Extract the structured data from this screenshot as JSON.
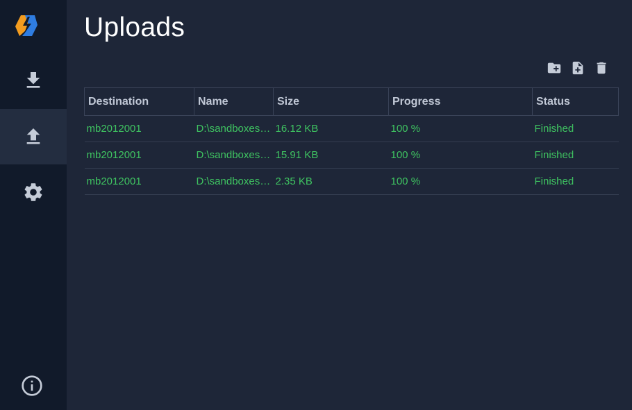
{
  "page": {
    "title": "Uploads"
  },
  "sidebar": {
    "logo": "app-logo",
    "items": [
      {
        "icon": "download-icon",
        "active": false
      },
      {
        "icon": "upload-icon",
        "active": true
      },
      {
        "icon": "gear-icon",
        "active": false
      }
    ],
    "footer_icon": "info-icon"
  },
  "toolbar": {
    "buttons": [
      {
        "icon": "add-folder-icon"
      },
      {
        "icon": "add-file-icon"
      },
      {
        "icon": "trash-icon"
      }
    ]
  },
  "table": {
    "columns": [
      "Destination",
      "Name",
      "Size",
      "Progress",
      "Status"
    ],
    "rows": [
      {
        "destination": "mb2012001",
        "name": "D:\\sandboxes\\...",
        "size": "16.12 KB",
        "progress": "100 %",
        "status": "Finished"
      },
      {
        "destination": "mb2012001",
        "name": "D:\\sandboxes\\...",
        "size": "15.91 KB",
        "progress": "100 %",
        "status": "Finished"
      },
      {
        "destination": "mb2012001",
        "name": "D:\\sandboxes\\...",
        "size": "2.35 KB",
        "progress": "100 %",
        "status": "Finished"
      }
    ]
  },
  "colors": {
    "background": "#1e2638",
    "sidebar": "#111a2a",
    "sidebar_active": "#232d40",
    "icon": "#c5ccd8",
    "status_green": "#3fc461",
    "logo_orange": "#f39c1f",
    "logo_blue": "#2f7de1"
  }
}
